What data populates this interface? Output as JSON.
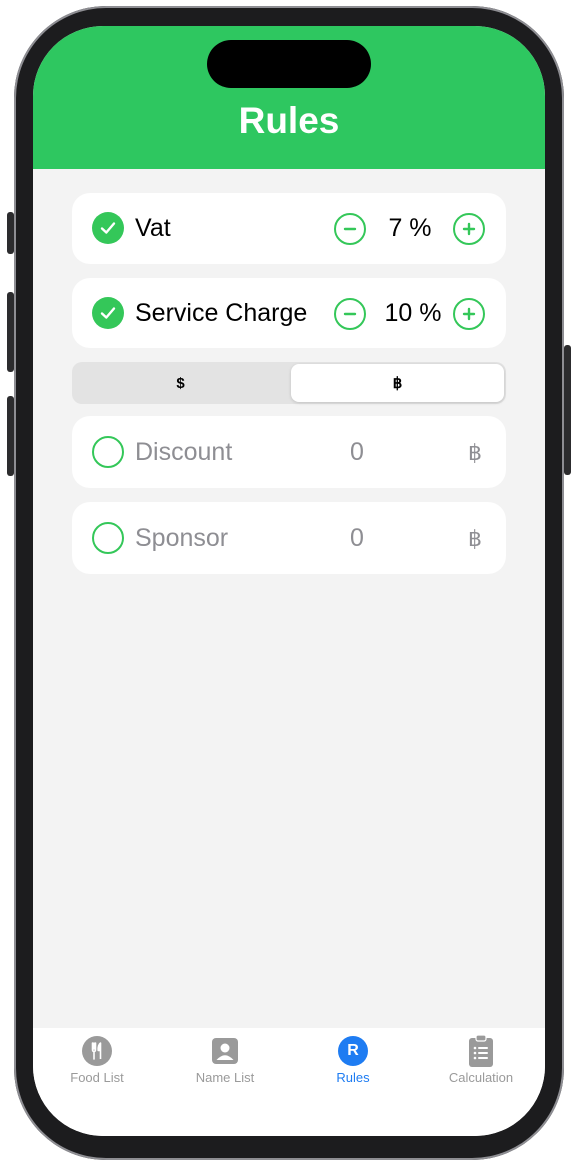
{
  "header": {
    "title": "Rules"
  },
  "rules": [
    {
      "label": "Vat",
      "value": "7 %",
      "checked": true
    },
    {
      "label": "Service Charge",
      "value": "10 %",
      "checked": true
    }
  ],
  "currency_toggle": {
    "options": [
      "$",
      "฿"
    ],
    "selected": "฿"
  },
  "adjustments": [
    {
      "label": "Discount",
      "value": "0",
      "currency": "฿",
      "checked": false
    },
    {
      "label": "Sponsor",
      "value": "0",
      "currency": "฿",
      "checked": false
    }
  ],
  "tabbar": {
    "items": [
      {
        "label": "Food List",
        "icon": "fork-knife-icon"
      },
      {
        "label": "Name List",
        "icon": "person-icon"
      },
      {
        "label": "Rules",
        "icon": "r-circle-icon",
        "active": true,
        "icon_text": "R"
      },
      {
        "label": "Calculation",
        "icon": "clipboard-icon"
      }
    ]
  },
  "colors": {
    "accent_green": "#34c759",
    "header_green": "#2ec760",
    "active_blue": "#1e7cf2"
  }
}
